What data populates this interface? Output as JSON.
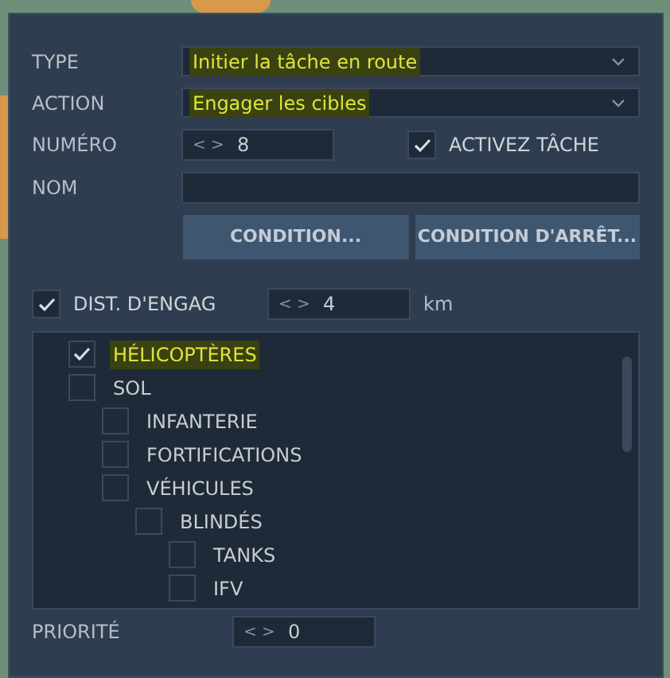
{
  "form": [
    {
      "kind": "select",
      "label": "TYPE",
      "value": "Initier la tâche en route",
      "highlighted": true
    },
    {
      "kind": "select",
      "label": "ACTION",
      "value": "Engager les cibles",
      "highlighted": true
    }
  ],
  "number": {
    "label": "NUMÉRO",
    "arrows": "< >",
    "value": "8"
  },
  "enable_task": {
    "label": "ACTIVEZ TÂCHE",
    "checked": true
  },
  "name": {
    "label": "NOM"
  },
  "buttons": [
    "CONDITION...",
    "CONDITION D'ARRÊT..."
  ],
  "distance": {
    "label": "DIST. D'ENGAG",
    "checked": true,
    "arrows": "< >",
    "value": "4",
    "unit": "km"
  },
  "targets": [
    {
      "label": "HÉLICOPTÈRES",
      "checked": true,
      "highlighted": true
    },
    {
      "label": "SOL",
      "checked": false,
      "highlighted": false,
      "children": [
        {
          "label": "INFANTERIE",
          "checked": false,
          "highlighted": false
        },
        {
          "label": "FORTIFICATIONS",
          "checked": false,
          "highlighted": false
        },
        {
          "label": "VÉHICULES",
          "checked": false,
          "highlighted": false,
          "children": [
            {
              "label": "BLINDÉS",
              "checked": false,
              "highlighted": false,
              "children": [
                {
                  "label": "TANKS",
                  "checked": false,
                  "highlighted": false
                },
                {
                  "label": "IFV",
                  "checked": false,
                  "highlighted": false
                }
              ]
            }
          ]
        }
      ]
    }
  ],
  "priority": {
    "label": "PRIORITÉ",
    "arrows": "< >",
    "value": "0"
  }
}
